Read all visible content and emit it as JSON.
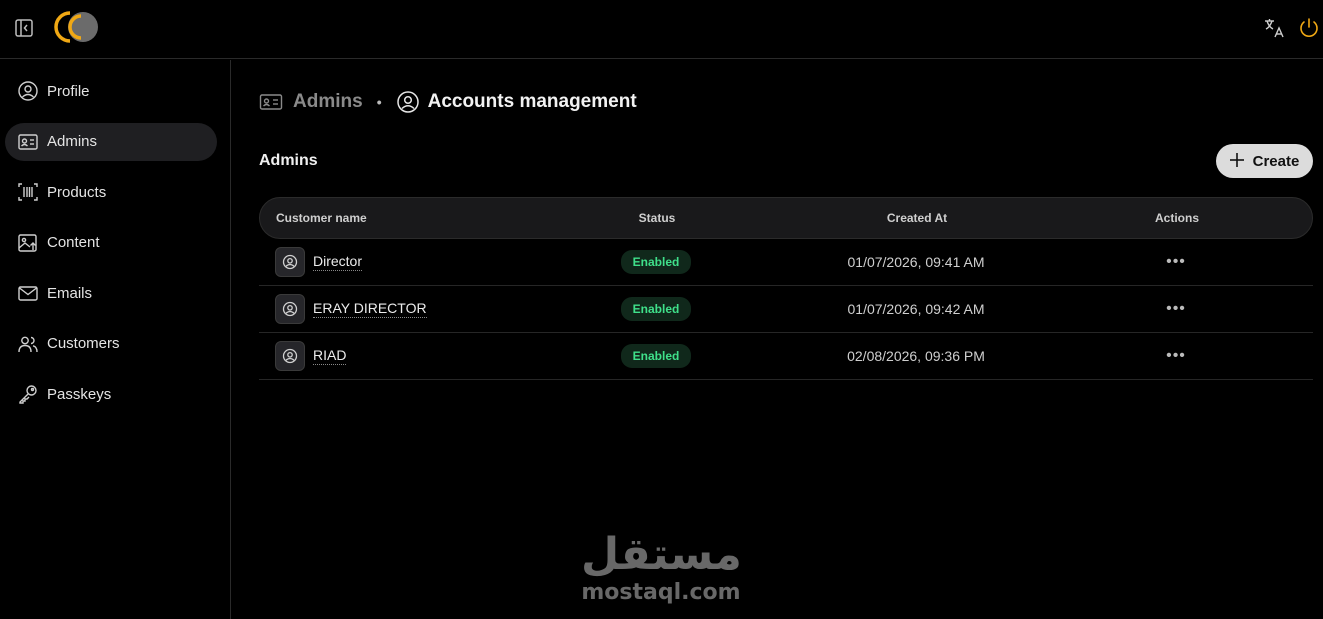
{
  "header": {
    "icons": [
      "sidebar-toggle-icon",
      "logo",
      "translate-icon",
      "power-icon"
    ],
    "accent_color": "#f0a814"
  },
  "sidebar": {
    "items": [
      {
        "label": "Profile",
        "icon": "user-circle-icon",
        "active": false
      },
      {
        "label": "Admins",
        "icon": "id-card-icon",
        "active": true
      },
      {
        "label": "Products",
        "icon": "barcode-icon",
        "active": false
      },
      {
        "label": "Content",
        "icon": "image-upload-icon",
        "active": false
      },
      {
        "label": "Emails",
        "icon": "mail-icon",
        "active": false
      },
      {
        "label": "Customers",
        "icon": "users-icon",
        "active": false
      },
      {
        "label": "Passkeys",
        "icon": "key-icon",
        "active": false
      }
    ]
  },
  "breadcrumb": {
    "parent": "Admins",
    "separator": "•",
    "current": "Accounts management"
  },
  "section": {
    "title": "Admins",
    "create_label": "Create"
  },
  "table": {
    "columns": {
      "name": "Customer name",
      "status": "Status",
      "created": "Created At",
      "actions": "Actions"
    },
    "rows": [
      {
        "name": "Director",
        "status": "Enabled",
        "created": "01/07/2026, 09:41 AM",
        "actions": "•••"
      },
      {
        "name": "ERAY DIRECTOR",
        "status": "Enabled",
        "created": "01/07/2026, 09:42 AM",
        "actions": "•••"
      },
      {
        "name": "RIAD",
        "status": "Enabled",
        "created": "02/08/2026, 09:36 PM",
        "actions": "•••"
      }
    ]
  },
  "watermark": {
    "arabic": "مستقل",
    "latin": "mostaql.com"
  }
}
